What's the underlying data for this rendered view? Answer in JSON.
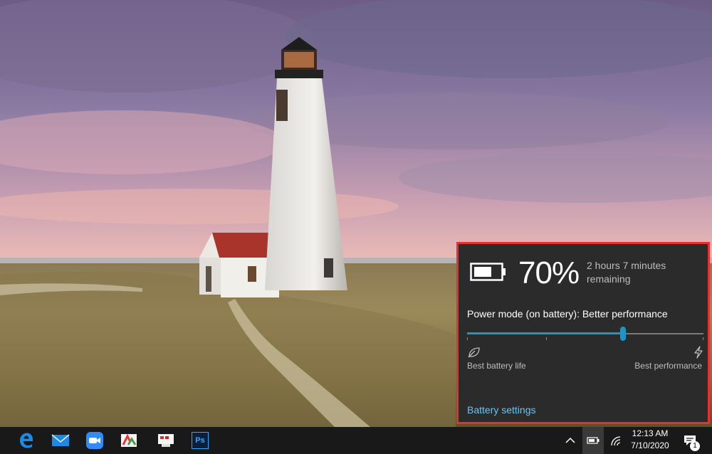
{
  "flyout": {
    "battery_percent": "70%",
    "time_remaining": "2 hours 7 minutes remaining",
    "power_mode_label": "Power mode (on battery): Better performance",
    "slider_value_fraction": 0.66,
    "slider_left_label": "Best battery life",
    "slider_right_label": "Best performance",
    "settings_link": "Battery settings",
    "accent_color": "#1b96c8",
    "highlight_border_color": "#e8312f"
  },
  "taskbar": {
    "pinned_apps": [
      "edge-icon",
      "mail-icon",
      "zoom-icon",
      "photos-icon",
      "app-icon",
      "photoshop-icon"
    ],
    "photoshop_label": "Ps",
    "tray_icons": [
      "chevron-up-icon",
      "battery-icon",
      "wifi-icon",
      "notifications-icon"
    ],
    "time": "12:13 AM",
    "date": "7/10/2020",
    "notification_count": "1"
  },
  "wallpaper": {
    "description_icon": "lighthouse-wallpaper"
  }
}
